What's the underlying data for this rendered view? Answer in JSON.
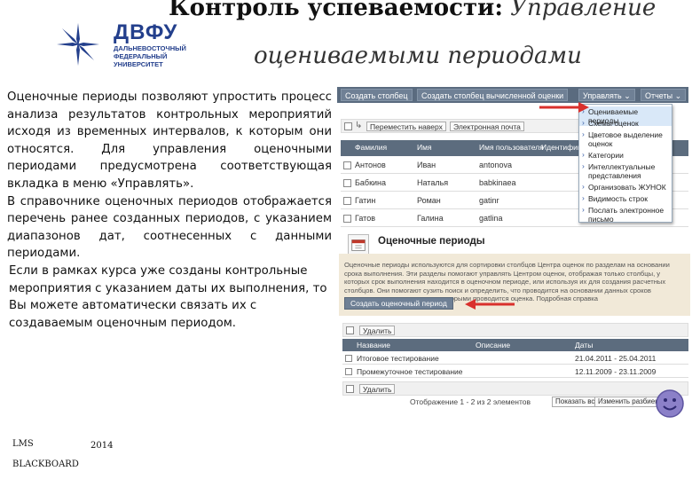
{
  "header": {
    "title_bold": "Контроль успеваемости:",
    "title_italic_1": "Управление",
    "title_italic_2": "оцениваемыми периодами",
    "logo_name": "ДВФУ",
    "logo_sub": [
      "ДАЛЬНЕВОСТОЧНЫЙ",
      "ФЕДЕРАЛЬНЫЙ",
      "УНИВЕРСИТЕТ"
    ]
  },
  "body": {
    "p1": "Оценочные периоды позволяют упростить процесс анализа результатов контрольных мероприятий исходя из временных интервалов, к которым они относятся. Для управления оценочными периодами предусмотрена соответствующая вкладка в меню «Управлять».",
    "p2": "В справочнике оценочных периодов отображается перечень ранее созданных периодов, с указанием диапазонов дат, соотнесенных с данными периодами.",
    "p3": "Если в рамках курса уже созданы контрольные мероприятия с указанием даты их выполнения, то Вы можете автоматически связать их с создаваемым оценочным периодом."
  },
  "footer": {
    "lms": "LMS",
    "bb": "BLACKBOARD",
    "year": "2014"
  },
  "shot1": {
    "toolbar": [
      "Создать столбец",
      "Создать столбец вычисленной оценки",
      "Управлять",
      "Отчеты"
    ],
    "bar_buttons": [
      "Переместить наверх",
      "Электронная почта"
    ],
    "headers": [
      "Фамилия",
      "Имя",
      "Имя пользователя",
      "Идентифика"
    ],
    "rows": [
      [
        "Антонов",
        "Иван",
        "antonova"
      ],
      [
        "Бабкина",
        "Наталья",
        "babkinaea"
      ],
      [
        "Гатин",
        "Роман",
        "gatinr"
      ],
      [
        "Гатов",
        "Галина",
        "gatlina"
      ]
    ],
    "menu": [
      "Оцениваемые периоды",
      "Схемы оценок",
      "Цветовое выделение оценок",
      "Категории",
      "Интеллектуальные представления",
      "Организовать ЖУНОК",
      "Видимость строк",
      "Послать электронное письмо"
    ]
  },
  "shot2": {
    "title": "Оценочные периоды",
    "desc": "Оценочные периоды используются для сортировки столбцов Центра оценок по разделам на основании срока выполнения. Эти разделы помогают управлять Центром оценок, отображая только столбцы, у которых срок выполнения находится в оценочном периоде, или используя их для создания расчетных столбцов. Они помогают сузить поиск и определить, что проводится на основании данных сроков выполнения, или даты, между которыми проводится оценка. Подробная справка",
    "button": "Создать оценочный период"
  },
  "shot3": {
    "delete": "Удалить",
    "headers": [
      "Название",
      "Описание",
      "Даты"
    ],
    "rows": [
      [
        "Итоговое тестирование",
        "21.04.2011 - 25.04.2011"
      ],
      [
        "Промежуточное тестирование",
        "12.11.2009 - 23.11.2009"
      ]
    ],
    "pager": "Отображение 1 - 2 из 2 элементов",
    "pager_buttons": [
      "Показать все",
      "Изменить разбиение"
    ]
  },
  "colors": {
    "toolbar": "#5a6b7f",
    "brand_blue": "#233f8c",
    "arrow_red": "#d9302c",
    "band": "#f1e9d8"
  }
}
